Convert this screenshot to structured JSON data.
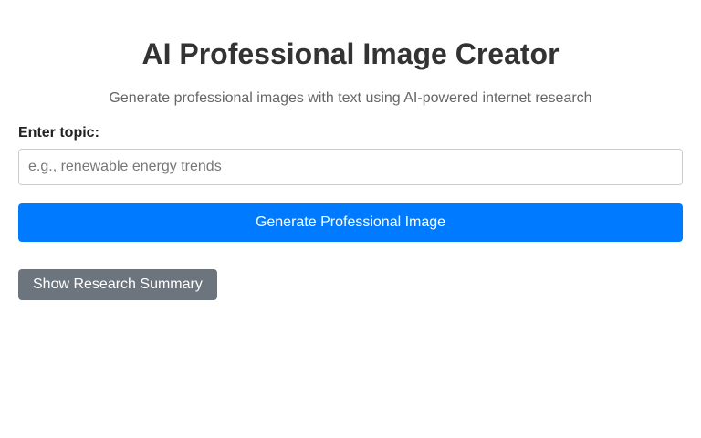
{
  "header": {
    "title": "AI Professional Image Creator",
    "subtitle": "Generate professional images with text using AI-powered internet research"
  },
  "form": {
    "topic_label": "Enter topic:",
    "topic_value": "",
    "topic_placeholder": "e.g., renewable energy trends",
    "generate_label": "Generate Professional Image"
  },
  "research": {
    "toggle_label": "Show Research Summary"
  },
  "colors": {
    "primary_button": "#007bff",
    "secondary_button": "#6c757d",
    "title_text": "#333333"
  }
}
